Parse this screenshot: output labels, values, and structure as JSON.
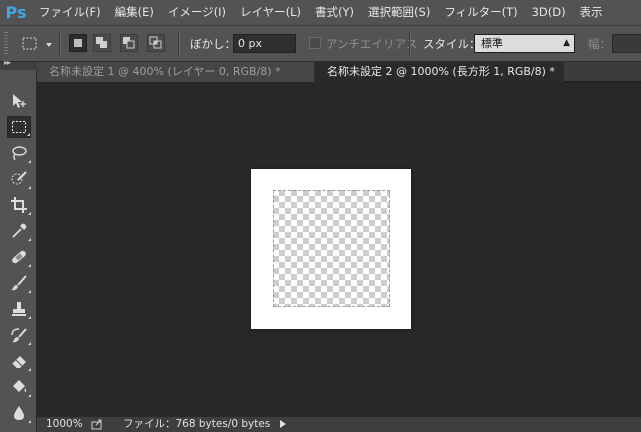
{
  "app": {
    "logo": "Ps"
  },
  "menu": [
    "ファイル(F)",
    "編集(E)",
    "イメージ(I)",
    "レイヤー(L)",
    "書式(Y)",
    "選択範囲(S)",
    "フィルター(T)",
    "3D(D)",
    "表示"
  ],
  "options": {
    "feather_label": "ぼかし：",
    "feather_value": "0 px",
    "antialias_label": "アンチエイリアス",
    "style_label": "スタイル：",
    "style_value": "標準",
    "width_label": "幅："
  },
  "tabs": [
    {
      "label": "名称未設定 1 @ 400% (レイヤー 0, RGB/8) *",
      "active": false
    },
    {
      "label": "名称未設定 2 @ 1000% (長方形 1, RGB/8) *",
      "active": true
    }
  ],
  "status": {
    "zoom": "1000%",
    "info": "ファイル：768 bytes/0 bytes"
  },
  "colors": {
    "panel": "#535353",
    "canvas_bg": "#282828",
    "accent": "#3fa7e6"
  },
  "tools": [
    "move-tool-icon",
    "rectangular-marquee-icon",
    "lasso-icon",
    "quick-selection-icon",
    "crop-icon",
    "eyedropper-icon",
    "spot-healing-icon",
    "brush-icon",
    "clone-stamp-icon",
    "history-brush-icon",
    "eraser-icon",
    "paint-bucket-icon",
    "blur-drop-icon"
  ]
}
